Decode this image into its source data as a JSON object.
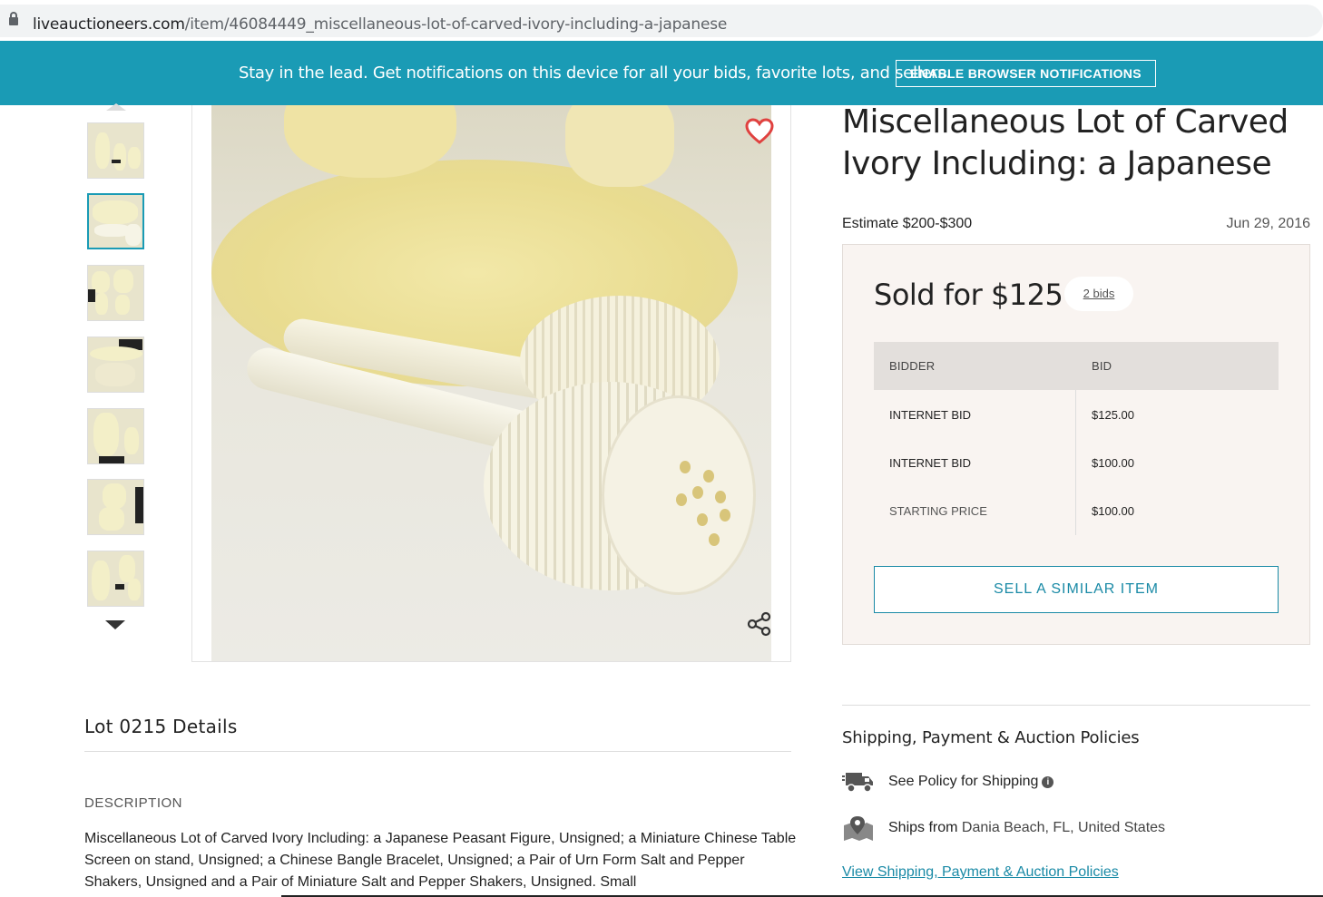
{
  "browser": {
    "url_host": "liveauctioneers.com",
    "url_path": "/item/46084449_miscellaneous-lot-of-carved-ivory-including-a-japanese"
  },
  "banner": {
    "text": "Stay in the lead. Get notifications on this device for all your bids, favorite lots, and sellers.",
    "button_label": "ENABLE BROWSER NOTIFICATIONS",
    "color": "#1a9bb5"
  },
  "gallery": {
    "thumbnail_count": 7,
    "active_index": 1
  },
  "item": {
    "title": "Miscellaneous Lot of Carved Ivory Including: a Japanese",
    "estimate": "Estimate $200-$300",
    "date": "Jun 29, 2016"
  },
  "sold": {
    "label": "Sold for $125",
    "bids_link": "2 bids",
    "table_headers": [
      "BIDDER",
      "BID"
    ],
    "rows": [
      {
        "bidder": "INTERNET BID",
        "bid": "$125.00"
      },
      {
        "bidder": "INTERNET BID",
        "bid": "$100.00"
      },
      {
        "bidder": "STARTING PRICE",
        "bid": "$100.00"
      }
    ],
    "sell_button": "SELL A SIMILAR ITEM"
  },
  "details": {
    "title": "Lot 0215 Details",
    "description_heading": "DESCRIPTION",
    "description": "Miscellaneous Lot of Carved Ivory Including: a Japanese Peasant Figure, Unsigned; a Miniature Chinese Table Screen on stand, Unsigned; a Chinese Bangle Bracelet, Unsigned; a Pair of Urn Form Salt and Pepper Shakers, Unsigned and a Pair of Miniature Salt and Pepper Shakers, Unsigned. Small"
  },
  "shipping": {
    "heading": "Shipping, Payment & Auction Policies",
    "policy_label": "See Policy for Shipping",
    "ships_from_label": "Ships from",
    "ships_from_location": "Dania Beach, FL, United States",
    "link": "View Shipping, Payment & Auction Policies"
  },
  "icons": [
    "lock-icon",
    "heart-icon",
    "share-icon",
    "truck-icon",
    "map-icon",
    "info-icon",
    "chevron-up-icon",
    "chevron-down-icon"
  ]
}
